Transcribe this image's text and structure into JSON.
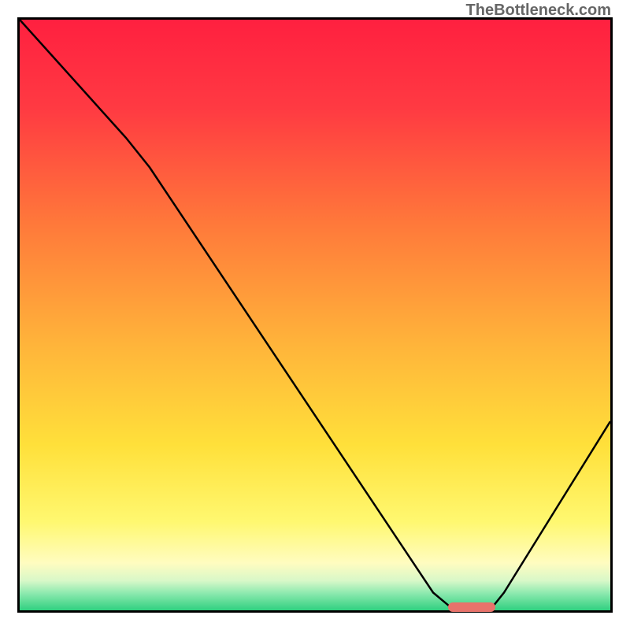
{
  "watermark": "TheBottleneck.com",
  "chart_data": {
    "type": "line",
    "title": "",
    "xlabel": "",
    "ylabel": "",
    "xlim": [
      0,
      100
    ],
    "ylim": [
      0,
      100
    ],
    "curve_points": [
      {
        "x": 0,
        "y": 100
      },
      {
        "x": 18,
        "y": 80
      },
      {
        "x": 22,
        "y": 75
      },
      {
        "x": 70,
        "y": 3
      },
      {
        "x": 73,
        "y": 0.5
      },
      {
        "x": 80,
        "y": 0.5
      },
      {
        "x": 82,
        "y": 3
      },
      {
        "x": 100,
        "y": 32
      }
    ],
    "marker": {
      "x_start": 73,
      "x_end": 80,
      "y": 0.5,
      "color": "#e8736b"
    },
    "gradient_stops": [
      {
        "offset": 0,
        "color": "#ff2040"
      },
      {
        "offset": 15,
        "color": "#ff3a42"
      },
      {
        "offset": 35,
        "color": "#ff7a3a"
      },
      {
        "offset": 55,
        "color": "#ffb43a"
      },
      {
        "offset": 72,
        "color": "#ffe03a"
      },
      {
        "offset": 85,
        "color": "#fff870"
      },
      {
        "offset": 92,
        "color": "#fffcc0"
      },
      {
        "offset": 95,
        "color": "#d8f8c8"
      },
      {
        "offset": 97,
        "color": "#90eab0"
      },
      {
        "offset": 100,
        "color": "#30d080"
      }
    ]
  }
}
